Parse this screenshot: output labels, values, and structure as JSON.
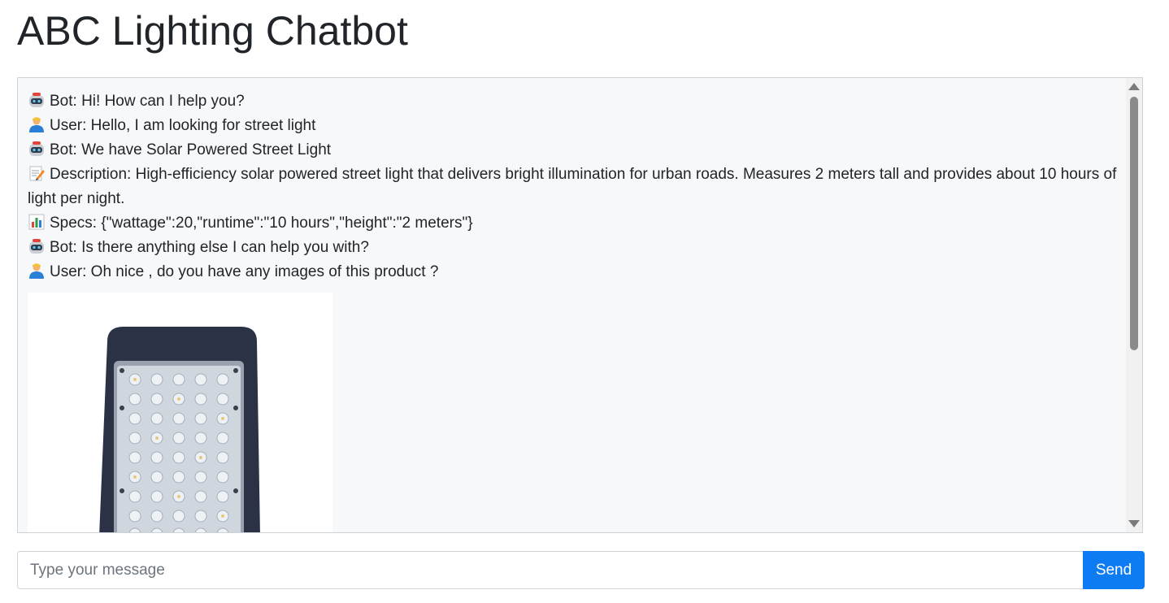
{
  "header": {
    "title": "ABC Lighting Chatbot"
  },
  "chat": {
    "messages": [
      {
        "icon": "robot-icon",
        "text": "Bot: Hi! How can I help you?"
      },
      {
        "icon": "user-icon",
        "text": "User: Hello, I am looking for street light"
      },
      {
        "icon": "robot-icon",
        "text": "Bot: We have Solar Powered Street Light"
      },
      {
        "icon": "memo-icon",
        "text": "Description: High-efficiency solar powered street light that delivers bright illumination for urban roads. Measures 2 meters tall and provides about 10 hours of light per night."
      },
      {
        "icon": "bar-chart-icon",
        "text": "Specs: {\"wattage\":20,\"runtime\":\"10 hours\",\"height\":\"2 meters\"}"
      },
      {
        "icon": "robot-icon",
        "text": "Bot: Is there anything else I can help you with?"
      },
      {
        "icon": "user-icon",
        "text": "User: Oh nice , do you have any images of this product ?"
      }
    ],
    "image": {
      "subject": "street-light-product-image"
    }
  },
  "input": {
    "placeholder": "Type your message",
    "value": "",
    "send_label": "Send"
  },
  "colors": {
    "accent": "#0d7cf2",
    "chat_background": "#f7f8fa",
    "text": "#212529"
  }
}
